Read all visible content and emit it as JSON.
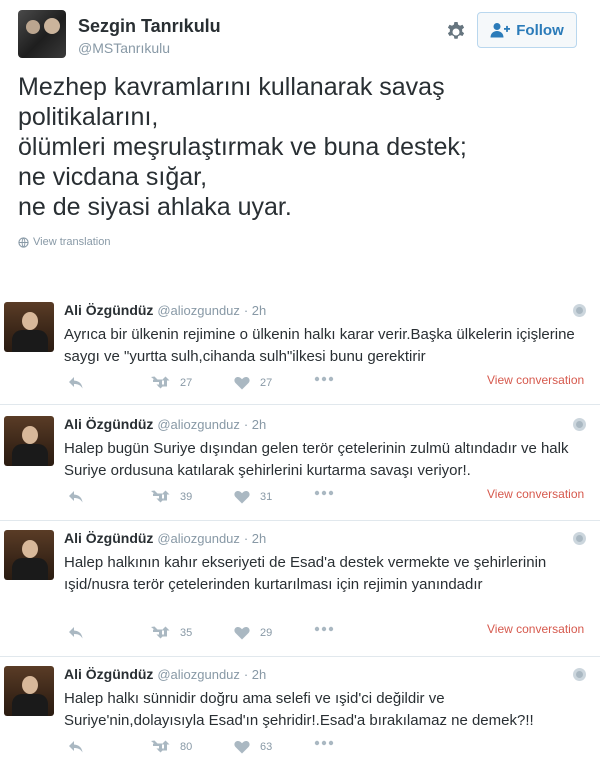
{
  "profile": {
    "name": "Sezgin Tanrıkulu",
    "handle": "@MSTanrıkulu",
    "follow_label": "Follow"
  },
  "tweet": {
    "text": "Mezhep kavramlarını kullanarak savaş\npolitikalarını,\nölümleri meşrulaştırmak ve buna destek;\nne vicdana sığar,\nne de siyasi ahlaka uyar.",
    "translation_label": "View translation"
  },
  "replies": [
    {
      "name": "Ali Özgündüz",
      "handle": "@aliozgunduz",
      "time": "· 2h",
      "text": "Ayrıca bir ülkenin rejimine o ülkenin halkı karar verir.Başka ülkelerin içişlerine saygı ve \"yurtta sulh,cihanda sulh\"ilkesi bunu gerektirir",
      "retweets": "27",
      "likes": "27",
      "view_conversation": "View conversation"
    },
    {
      "name": "Ali Özgündüz",
      "handle": "@aliozgunduz",
      "time": "· 2h",
      "text": "Halep bugün Suriye dışından gelen terör çetelerinin zulmü altındadır ve halk Suriye ordusuna katılarak şehirlerini kurtarma savaşı veriyor!.",
      "retweets": "39",
      "likes": "31",
      "view_conversation": "View conversation"
    },
    {
      "name": "Ali Özgündüz",
      "handle": "@aliozgunduz",
      "time": "· 2h",
      "text": "Halep halkının kahır ekseriyeti de Esad'a destek vermekte ve şehirlerinin ışid/nusra terör çetelerinden kurtarılması için rejimin yanındadır",
      "retweets": "35",
      "likes": "29",
      "view_conversation": "View conversation"
    },
    {
      "name": "Ali Özgündüz",
      "handle": "@aliozgunduz",
      "time": "· 2h",
      "text": "Halep halkı sünnidir doğru ama selefi ve ışid'ci değildir ve Suriye'nin,dolayısıyla Esad'ın şehridir!.Esad'a bırakılamaz ne demek?!!",
      "retweets": "80",
      "likes": "63"
    }
  ],
  "colors": {
    "text": "#292f33",
    "muted": "#8899a6",
    "follow_blue": "#2b7bb9",
    "view_conversation": "#d6594d"
  },
  "icons": {
    "settings": "gear-icon",
    "follow": "add-user-icon",
    "translate": "globe-icon",
    "reply": "reply-icon",
    "retweet": "retweet-icon",
    "like": "heart-icon",
    "more": "more-icon",
    "dismiss": "close-icon"
  }
}
